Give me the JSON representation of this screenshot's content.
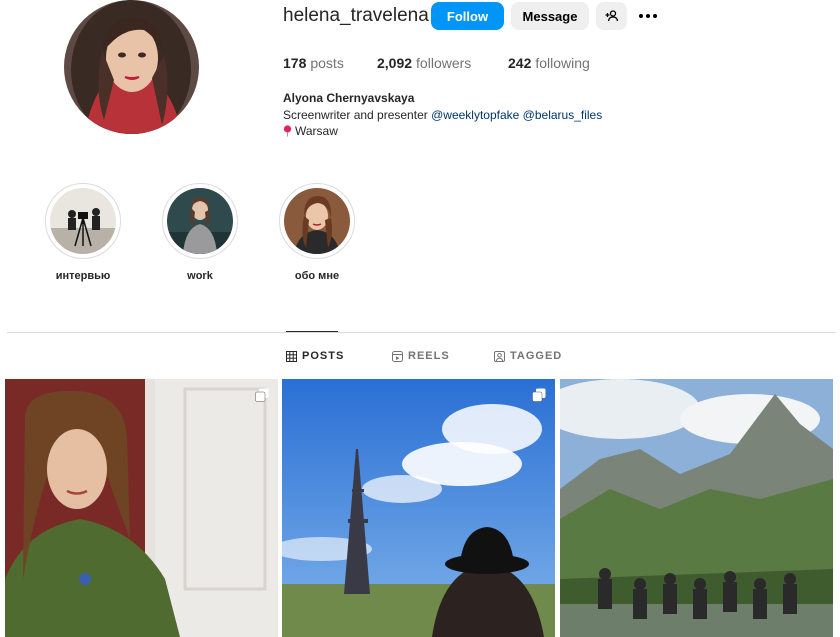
{
  "profile": {
    "username": "helena_travelena",
    "follow_label": "Follow",
    "message_label": "Message",
    "full_name": "Alyona Chernyavskaya",
    "bio_text": "Screenwriter and presenter",
    "mention_1": "@weeklytopfake",
    "mention_2": "@belarus_files",
    "location": "Warsaw"
  },
  "stats": {
    "posts_count": "178",
    "posts_label": "posts",
    "followers_count": "2,092",
    "followers_label": "followers",
    "following_count": "242",
    "following_label": "following"
  },
  "highlights": [
    {
      "label": "интервью"
    },
    {
      "label": "work"
    },
    {
      "label": "обо мне"
    }
  ],
  "tabs": [
    {
      "label": "POSTS",
      "icon": "grid-icon",
      "active": true
    },
    {
      "label": "REELS",
      "icon": "reels-icon",
      "active": false
    },
    {
      "label": "TAGGED",
      "icon": "tagged-icon",
      "active": false
    }
  ],
  "colors": {
    "primary_button": "#0095f6",
    "secondary_button": "#efefef",
    "mention_link": "#00376b",
    "muted_text": "#737373"
  }
}
